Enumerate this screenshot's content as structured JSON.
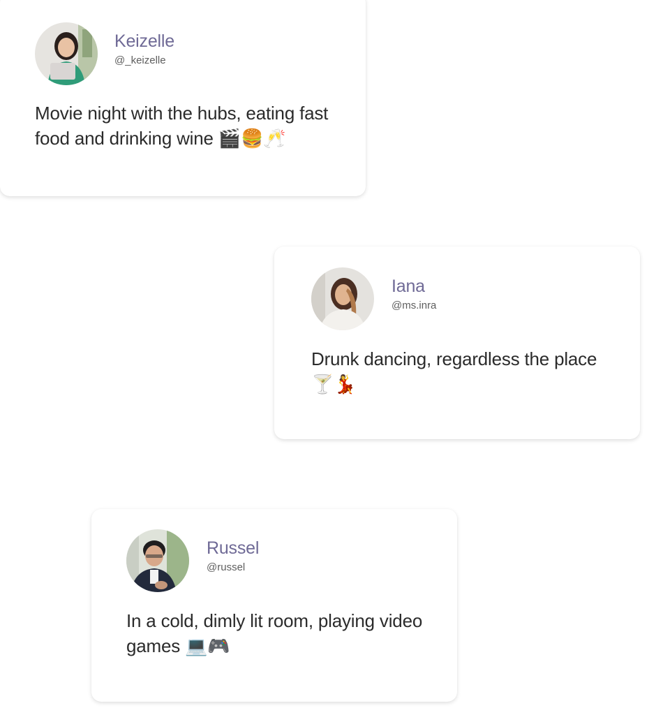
{
  "posts": [
    {
      "name": "Keizelle",
      "handle": "@_keizelle",
      "text": "Movie night with the hubs, eating fast food and drinking wine 🎬🍔🥂"
    },
    {
      "name": "Iana",
      "handle": "@ms.inra",
      "text": "Drunk dancing, regardless the place 🍸💃"
    },
    {
      "name": "Russel",
      "handle": "@russel",
      "text": "In a cold, dimly lit room, playing video games 💻🎮"
    }
  ],
  "colors": {
    "name": "#6f6a96",
    "handle": "#5e5e5e",
    "text": "#2b2b2b",
    "card_background": "#ffffff"
  }
}
